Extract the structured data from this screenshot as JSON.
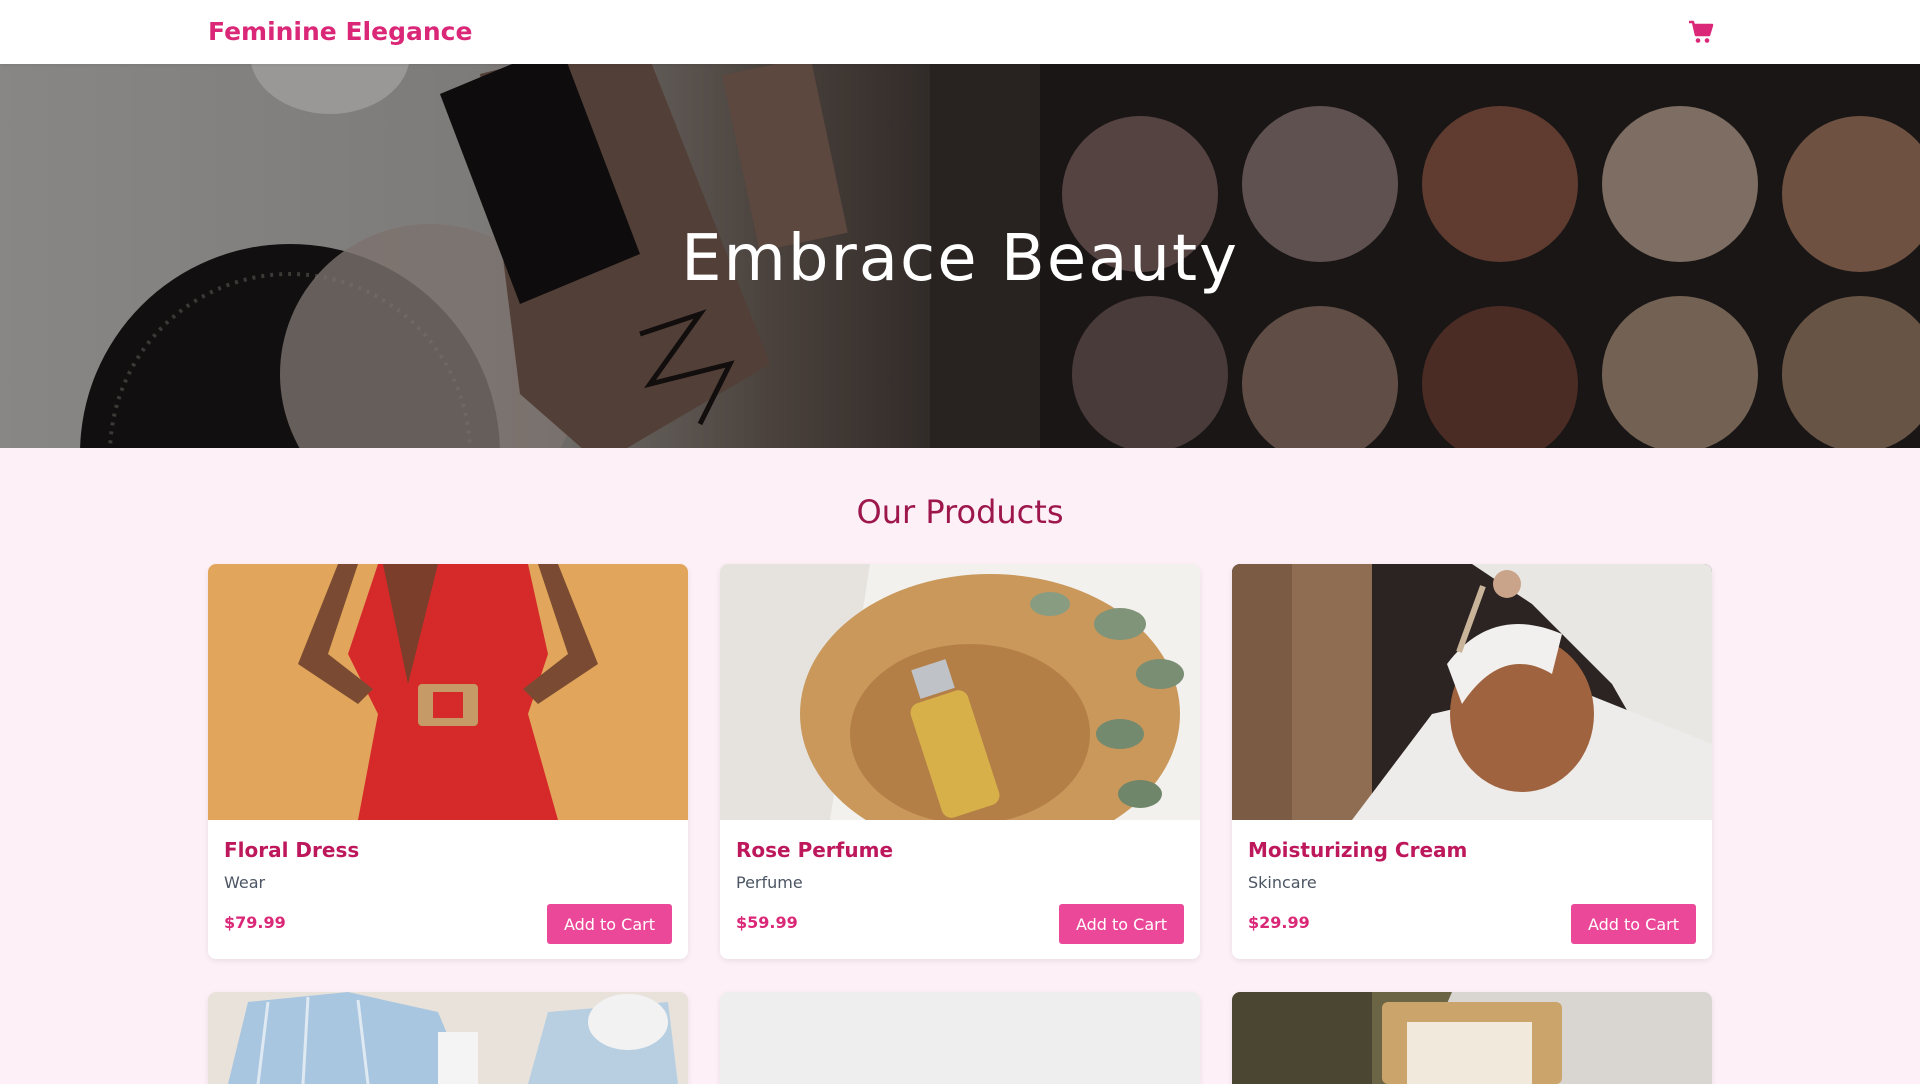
{
  "navbar": {
    "brand": "Feminine Elegance",
    "cart_icon": "shopping-cart-icon",
    "accent": "#db2777"
  },
  "hero": {
    "title": "Embrace Beauty"
  },
  "products_section": {
    "title": "Our Products",
    "items": [
      {
        "name": "Floral Dress",
        "category": "Wear",
        "price": "$79.99",
        "button": "Add to Cart"
      },
      {
        "name": "Rose Perfume",
        "category": "Perfume",
        "price": "$59.99",
        "button": "Add to Cart"
      },
      {
        "name": "Moisturizing Cream",
        "category": "Skincare",
        "price": "$29.99",
        "button": "Add to Cart"
      }
    ]
  },
  "colors": {
    "page_bg": "#fdf0f6",
    "button": "#ec4899",
    "title": "#9d174d",
    "product_name": "#be185d"
  }
}
